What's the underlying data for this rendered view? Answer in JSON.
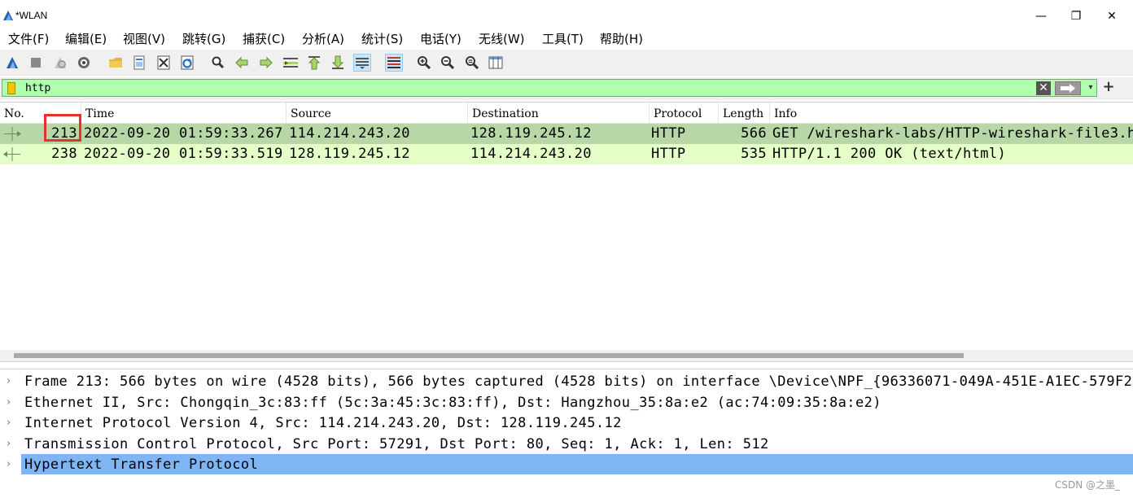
{
  "window": {
    "title": "*WLAN",
    "controls": {
      "minimize": "—",
      "maximize": "❐",
      "close": "✕"
    }
  },
  "menu": [
    "文件(F)",
    "编辑(E)",
    "视图(V)",
    "跳转(G)",
    "捕获(C)",
    "分析(A)",
    "统计(S)",
    "电话(Y)",
    "无线(W)",
    "工具(T)",
    "帮助(H)"
  ],
  "toolbar": {
    "buttons": [
      "start-capture-icon",
      "stop-capture-icon",
      "restart-capture-icon",
      "capture-options-icon",
      "open-file-icon",
      "save-file-icon",
      "close-file-icon",
      "reload-file-icon",
      "find-packet-icon",
      "go-back-icon",
      "go-forward-icon",
      "go-to-packet-icon",
      "go-first-icon",
      "go-last-icon",
      "autoscroll-icon",
      "colorize-icon",
      "zoom-in-icon",
      "zoom-out-icon",
      "zoom-normal-icon",
      "resize-columns-icon"
    ]
  },
  "filter": {
    "value": "http",
    "clear_label": "✕",
    "dropdown_label": "▾",
    "add_label": "+"
  },
  "packet_list": {
    "columns": [
      "No.",
      "Time",
      "Source",
      "Destination",
      "Protocol",
      "Length",
      "Info"
    ],
    "rows": [
      {
        "no": "213",
        "time": "2022-09-20 01:59:33.267",
        "source": "114.214.243.20",
        "destination": "128.119.245.12",
        "protocol": "HTTP",
        "length": "566",
        "info": "GET /wireshark-labs/HTTP-wireshark-file3.h"
      },
      {
        "no": "238",
        "time": "2022-09-20 01:59:33.519",
        "source": "128.119.245.12",
        "destination": "114.214.243.20",
        "protocol": "HTTP",
        "length": "535",
        "info": "HTTP/1.1 200 OK  (text/html)"
      }
    ],
    "selected_row_color": "#b7d7a6",
    "row_color": "#e4ffc7"
  },
  "details": {
    "items": [
      "Frame 213: 566 bytes on wire (4528 bits), 566 bytes captured (4528 bits) on interface \\Device\\NPF_{96336071-049A-451E-A1EC-579F2",
      "Ethernet II, Src: Chongqin_3c:83:ff (5c:3a:45:3c:83:ff), Dst: Hangzhou_35:8a:e2 (ac:74:09:35:8a:e2)",
      "Internet Protocol Version 4, Src: 114.214.243.20, Dst: 128.119.245.12",
      "Transmission Control Protocol, Src Port: 57291, Dst Port: 80, Seq: 1, Ack: 1, Len: 512",
      "Hypertext Transfer Protocol"
    ],
    "chevron": "›",
    "selected_color": "#7fb5f5"
  },
  "watermark": "CSDN @之墨_"
}
